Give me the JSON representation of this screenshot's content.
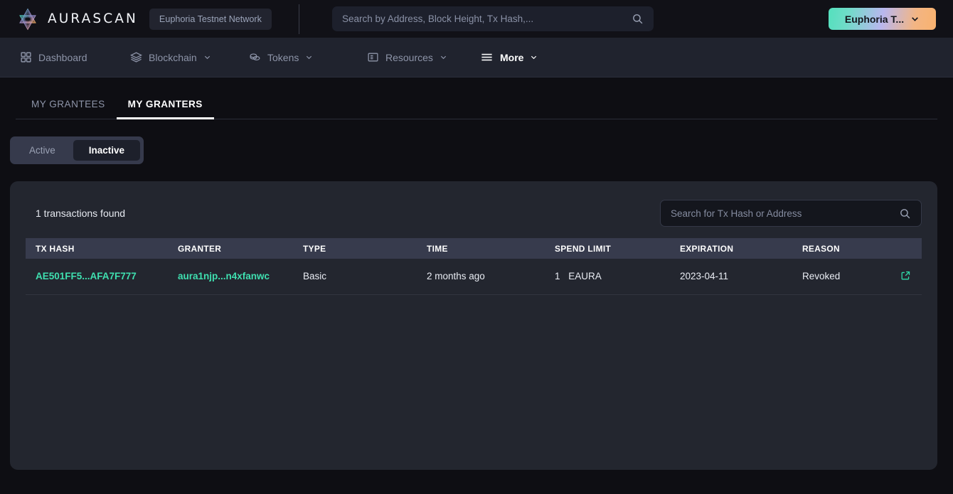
{
  "brand": {
    "name": "AURASCAN",
    "logo_icon": "aura-star-logo",
    "network_badge": "Euphoria Testnet Network"
  },
  "search": {
    "placeholder": "Search by Address, Block Height, Tx Hash,...",
    "value": "",
    "icon": "search-icon"
  },
  "wallet": {
    "label": "Euphoria T...",
    "icon": "chevron-down-icon",
    "gradient_from": "#54e0bd",
    "gradient_mid": "#b9b7ee",
    "gradient_to": "#f9b26e"
  },
  "nav": {
    "items": [
      {
        "label": "Dashboard",
        "icon": "grid-icon",
        "caret": false,
        "active": false
      },
      {
        "label": "Blockchain",
        "icon": "layers-icon",
        "caret": true,
        "active": false
      },
      {
        "label": "Tokens",
        "icon": "coins-icon",
        "caret": true,
        "active": false
      },
      {
        "label": "Resources",
        "icon": "book-icon",
        "caret": true,
        "active": false
      },
      {
        "label": "More",
        "icon": "hamburger-icon",
        "caret": true,
        "active": true
      }
    ]
  },
  "tabs": [
    {
      "label": "MY GRANTEES",
      "active": false
    },
    {
      "label": "MY GRANTERS",
      "active": true
    }
  ],
  "filter_toggle": {
    "options": [
      {
        "label": "Active",
        "active": false
      },
      {
        "label": "Inactive",
        "active": true
      }
    ]
  },
  "results": {
    "count_text": "1 transactions found",
    "search_placeholder": "Search for Tx Hash or Address",
    "search_value": "",
    "search_icon": "search-icon"
  },
  "table": {
    "columns": [
      "TX HASH",
      "GRANTER",
      "TYPE",
      "TIME",
      "SPEND LIMIT",
      "EXPIRATION",
      "REASON"
    ],
    "rows": [
      {
        "tx_hash": "AE501FF5...AFA7F777",
        "granter": "aura1njp...n4xfanwc",
        "type": "Basic",
        "time": "2 months ago",
        "spend_limit_value": "1",
        "spend_limit_unit": "EAURA",
        "expiration": "2023-04-11",
        "reason": "Revoked",
        "action_icon": "external-link-icon"
      }
    ]
  },
  "colors": {
    "page_bg": "#0e0e13",
    "topbar_bg": "#111117",
    "nav_bg": "#20232e",
    "card_bg": "#23262f",
    "table_header_bg": "#373b4d",
    "accent_link": "#3fe0b0"
  }
}
